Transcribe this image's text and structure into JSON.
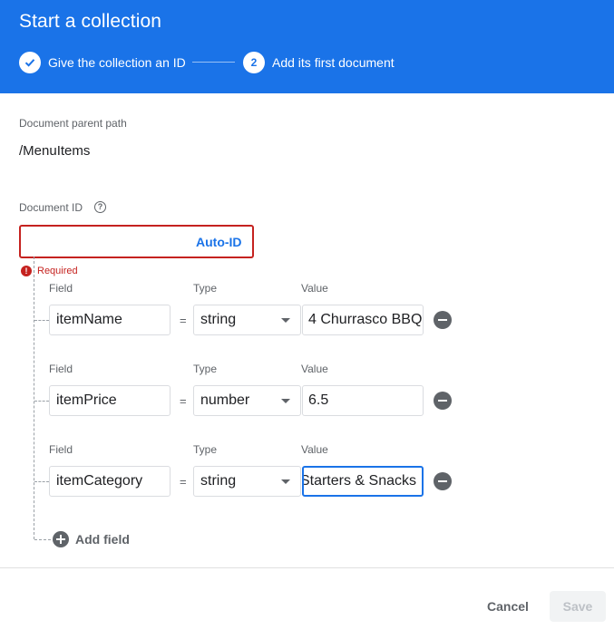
{
  "dialog": {
    "title": "Start a collection",
    "steps": [
      {
        "label": "Give the collection an ID",
        "status": "completed",
        "indicator": "check-icon"
      },
      {
        "label": "Add its first document",
        "status": "active",
        "number": "2"
      }
    ]
  },
  "parent_path": {
    "label": "Document parent path",
    "value": "/MenuItems"
  },
  "document_id": {
    "label": "Document ID",
    "value": "",
    "auto_id_label": "Auto-ID",
    "error": "Required",
    "help_icon": "help-circle-icon"
  },
  "field_headers": {
    "field": "Field",
    "type": "Type",
    "value": "Value",
    "equals": "="
  },
  "fields": [
    {
      "name": "itemName",
      "type": "string",
      "value": "4 Churrasco BBQ"
    },
    {
      "name": "itemPrice",
      "type": "number",
      "value": "6.5"
    },
    {
      "name": "itemCategory",
      "type": "string",
      "value": "Starters & Snacks"
    }
  ],
  "add_field_label": "Add field",
  "footer": {
    "cancel_label": "Cancel",
    "save_label": "Save"
  },
  "colors": {
    "header_bg": "#1a73e8",
    "accent": "#1a73e8",
    "error": "#c5221f"
  }
}
